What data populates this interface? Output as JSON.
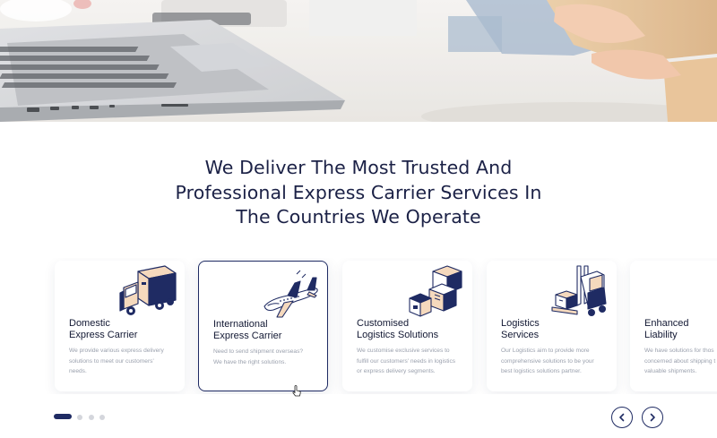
{
  "hero": {
    "image": "laptop-and-parcel-photo"
  },
  "headline": {
    "line1": "We Deliver The Most Trusted And",
    "line2": "Professional Express Carrier Services In",
    "line3": "The Countries We Operate"
  },
  "services": [
    {
      "title_line1": "Domestic",
      "title_line2": "Express Carrier",
      "desc_line1": "We provide various express delivery",
      "desc_line2": "solutions to meet our customers'",
      "desc_line3": "needs.",
      "icon": "delivery-truck-icon"
    },
    {
      "title_line1": "International",
      "title_line2": "Express Carrier",
      "desc_line1": "Need to send shipment overseas?",
      "desc_line2": "We have the right solutions.",
      "desc_line3": "",
      "icon": "airplane-icon",
      "active": true
    },
    {
      "title_line1": "Customised",
      "title_line2": "Logistics Solutions",
      "desc_line1": "We customise exclusive services to",
      "desc_line2": "fulfill our customers' needs in logistics",
      "desc_line3": "or express delivery segments.",
      "icon": "parcel-boxes-icon"
    },
    {
      "title_line1": "Logistics",
      "title_line2": "Services",
      "desc_line1": "Our Logistics aim to provide more",
      "desc_line2": "comprehensive solutions to be your",
      "desc_line3": "best logistics solutions partner.",
      "icon": "forklift-icon"
    },
    {
      "title_line1": "Enhanced",
      "title_line2": "Liability",
      "desc_line1": "We have solutions for thos",
      "desc_line2": "concerned about shipping t",
      "desc_line3": "valuable shipments.",
      "icon": "open-box-icon"
    }
  ],
  "pager": {
    "total": 4,
    "current": 1
  },
  "nav": {
    "prev_icon": "chevron-left-icon",
    "next_icon": "chevron-right-icon"
  },
  "colors": {
    "navy": "#1f2b63",
    "peach": "#f5d9bd",
    "title_text": "#1b2146",
    "body_text": "#9aa0ad"
  }
}
